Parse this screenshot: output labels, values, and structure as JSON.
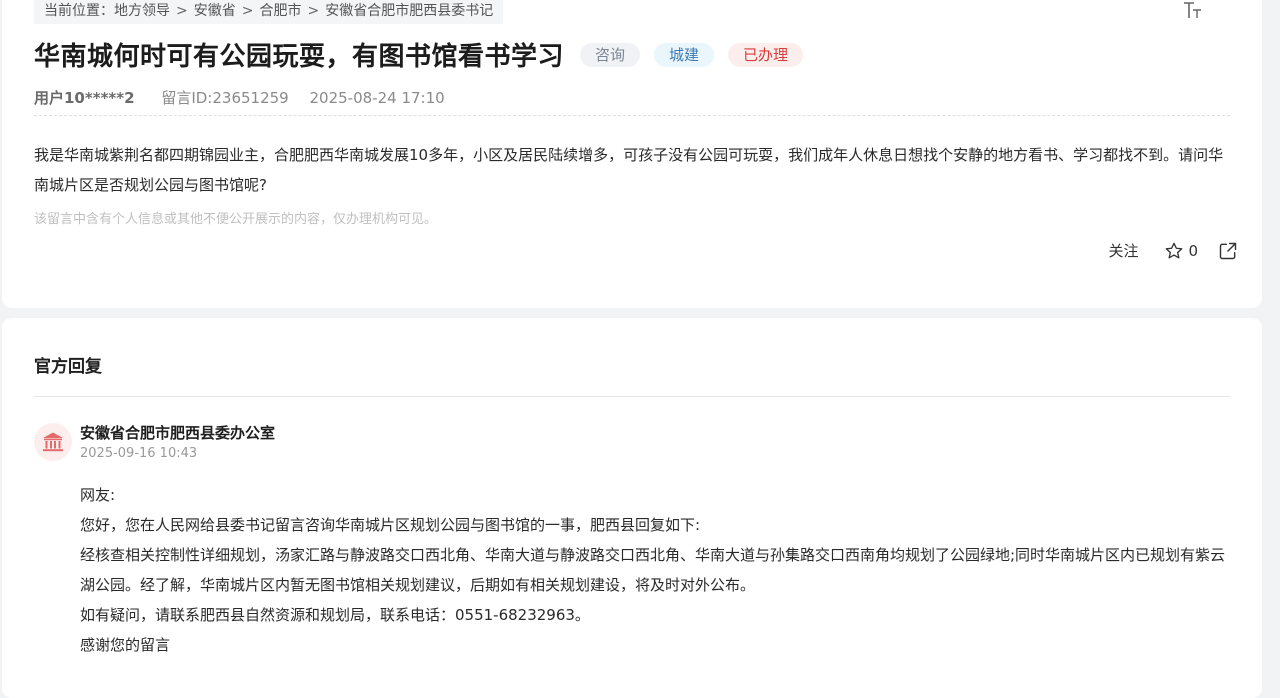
{
  "breadcrumb": {
    "prefix": "当前位置：",
    "items": [
      "地方领导",
      "安徽省",
      "合肥市",
      "安徽省合肥市肥西县委书记"
    ],
    "separator": ">"
  },
  "message": {
    "title": "华南城何时可有公园玩耍，有图书馆看书学习",
    "tags": {
      "category": "咨询",
      "field": "城建",
      "status": "已办理"
    },
    "user": "用户10*****2",
    "message_id": "留言ID:23651259",
    "time": "2025-08-24 17:10",
    "content": "我是华南城紫荆名都四期锦园业主，合肥肥西华南城发展10多年，小区及居民陆续增多，可孩子没有公园可玩耍，我们成年人休息日想找个安静的地方看书、学习都找不到。请问华南城片区是否规划公园与图书馆呢?",
    "notice": "该留言中含有个人信息或其他不便公开展示的内容，仅办理机构可见。"
  },
  "actions": {
    "follow_label": "关注",
    "favorite_count": "0"
  },
  "reply": {
    "header": "官方回复",
    "org_name": "安徽省合肥市肥西县委办公室",
    "time": "2025-09-16 10:43",
    "lines": [
      "网友:",
      "您好，您在人民网给县委书记留言咨询华南城片区规划公园与图书馆的一事，肥西县回复如下:",
      "经核查相关控制性详细规划，汤家汇路与静波路交口西北角、华南大道与静波路交口西北角、华南大道与孙集路交口西南角均规划了公园绿地;同时华南城片区内已规划有紫云湖公园。经了解，华南城片区内暂无图书馆相关规划建议，后期如有相关规划建设，将及时对外公布。",
      "如有疑问，请联系肥西县自然资源和规划局，联系电话：0551-68232963。",
      "感谢您的留言"
    ]
  },
  "colors": {
    "accent_red": "#d93a3a",
    "tag_blue": "#3f7bb5",
    "tag_gray": "#7b8594"
  }
}
